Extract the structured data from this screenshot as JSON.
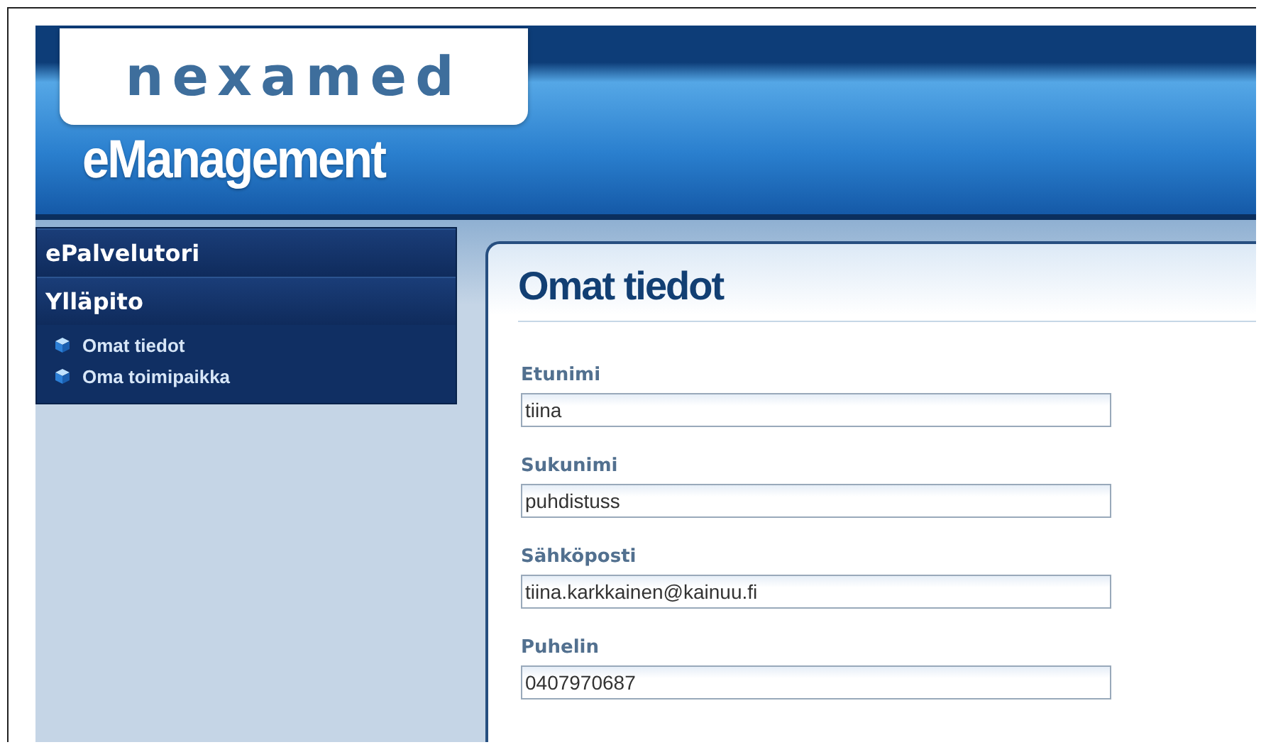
{
  "header": {
    "logo": "nexamed",
    "product": "eManagement"
  },
  "sidebar": {
    "sections": [
      {
        "label": "ePalvelutori"
      },
      {
        "label": "Ylläpito",
        "children": [
          {
            "label": "Omat tiedot"
          },
          {
            "label": "Oma toimipaikka"
          }
        ]
      }
    ]
  },
  "content": {
    "title": "Omat tiedot",
    "fields": [
      {
        "label": "Etunimi",
        "value": "tiina"
      },
      {
        "label": "Sukunimi",
        "value": "puhdistuss"
      },
      {
        "label": "Sähköposti",
        "value": "tiina.karkkainen@kainuu.fi"
      },
      {
        "label": "Puhelin",
        "value": "0407970687"
      }
    ]
  }
}
